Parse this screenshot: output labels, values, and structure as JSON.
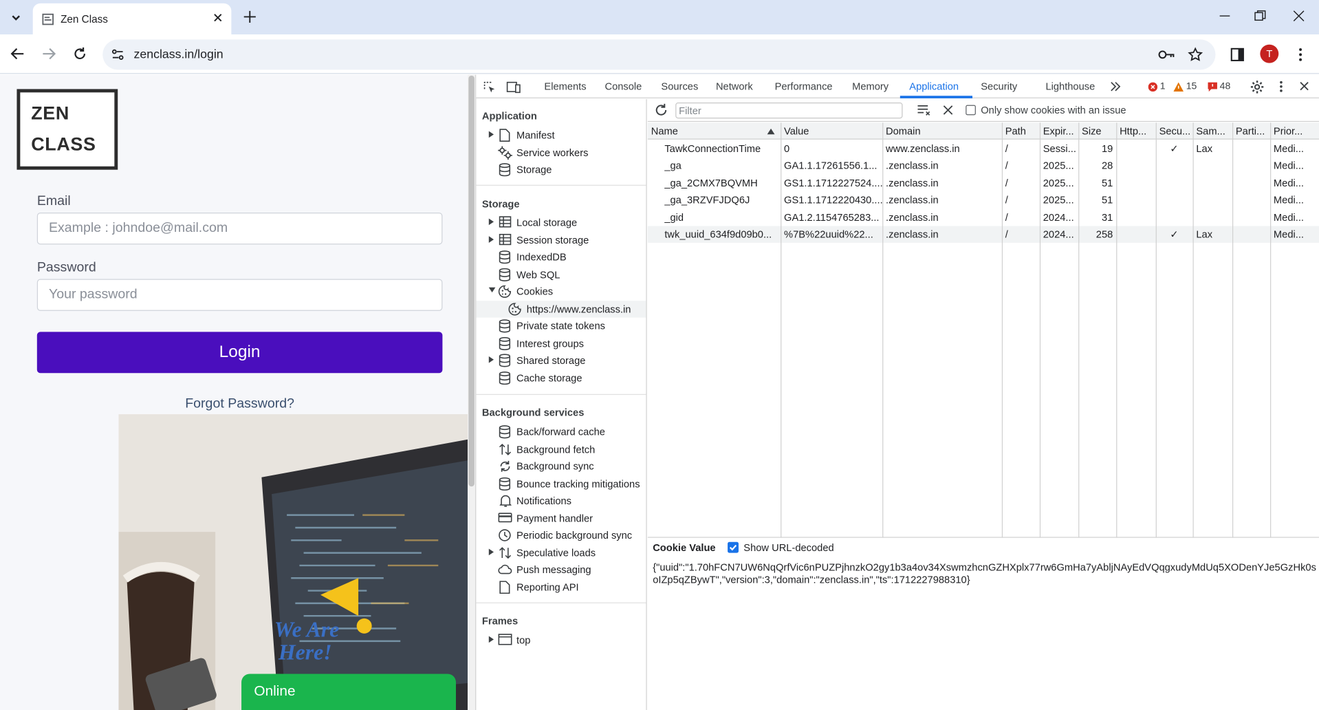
{
  "browser": {
    "tab_title": "Zen Class",
    "url": "zenclass.in/login",
    "avatar_letter": "T"
  },
  "page": {
    "logo_line1": "ZEN",
    "logo_line2": "CLASS",
    "email_label": "Email",
    "email_placeholder": "Example : johndoe@mail.com",
    "password_label": "Password",
    "password_placeholder": "Your password",
    "login_button": "Login",
    "forgot_link": "Forgot Password?",
    "online_label": "Online"
  },
  "devtools": {
    "tabs": [
      "Elements",
      "Console",
      "Sources",
      "Network",
      "Performance",
      "Memory",
      "Application",
      "Security",
      "Lighthouse"
    ],
    "active_tab": "Application",
    "errors": "1",
    "warnings": "15",
    "issues": "48",
    "accent_color": "#1a73e8",
    "sidebar": {
      "application_title": "Application",
      "application_items": [
        "Manifest",
        "Service workers",
        "Storage"
      ],
      "storage_title": "Storage",
      "storage_items": [
        "Local storage",
        "Session storage",
        "IndexedDB",
        "Web SQL",
        "Cookies",
        "https://www.zenclass.in",
        "Private state tokens",
        "Interest groups",
        "Shared storage",
        "Cache storage"
      ],
      "background_title": "Background services",
      "background_items": [
        "Back/forward cache",
        "Background fetch",
        "Background sync",
        "Bounce tracking mitigations",
        "Notifications",
        "Payment handler",
        "Periodic background sync",
        "Speculative loads",
        "Push messaging",
        "Reporting API"
      ],
      "frames_title": "Frames",
      "frames_items": [
        "top"
      ]
    },
    "cookies": {
      "filter_placeholder": "Filter",
      "only_issues_label": "Only show cookies with an issue",
      "columns": [
        "Name",
        "Value",
        "Domain",
        "Path",
        "Expir...",
        "Size",
        "Http...",
        "Secu...",
        "Sam...",
        "Parti...",
        "Prior..."
      ],
      "rows": [
        [
          "TawkConnectionTime",
          "0",
          "www.zenclass.in",
          "/",
          "Sessi...",
          "19",
          "",
          "✓",
          "Lax",
          "",
          "Medi..."
        ],
        [
          "_ga",
          "GA1.1.17261556.1...",
          ".zenclass.in",
          "/",
          "2025...",
          "28",
          "",
          "",
          "",
          "",
          "Medi..."
        ],
        [
          "_ga_2CMX7BQVMH",
          "GS1.1.1712227524....",
          ".zenclass.in",
          "/",
          "2025...",
          "51",
          "",
          "",
          "",
          "",
          "Medi..."
        ],
        [
          "_ga_3RZVFJDQ6J",
          "GS1.1.1712220430....",
          ".zenclass.in",
          "/",
          "2025...",
          "51",
          "",
          "",
          "",
          "",
          "Medi..."
        ],
        [
          "_gid",
          "GA1.2.1154765283...",
          ".zenclass.in",
          "/",
          "2024...",
          "31",
          "",
          "",
          "",
          "",
          "Medi..."
        ],
        [
          "twk_uuid_634f9d09b0...",
          "%7B%22uuid%22...",
          ".zenclass.in",
          "/",
          "2024...",
          "258",
          "",
          "✓",
          "Lax",
          "",
          "Medi..."
        ]
      ],
      "cookie_value_title": "Cookie Value",
      "show_decoded_label": "Show URL-decoded",
      "cookie_value": "{\"uuid\":\"1.70hFCN7UW6NqQrfVic6nPUZPjhnzkO2gy1b3a4ov34XswmzhcnGZHXplx77rw6GmHa7yAbljNAyEdVQqgxudyMdUq5XODenYJe5GzHk0soIZp5qZBywT\",\"version\":3,\"domain\":\"zenclass.in\",\"ts\":1712227988310}"
    }
  }
}
